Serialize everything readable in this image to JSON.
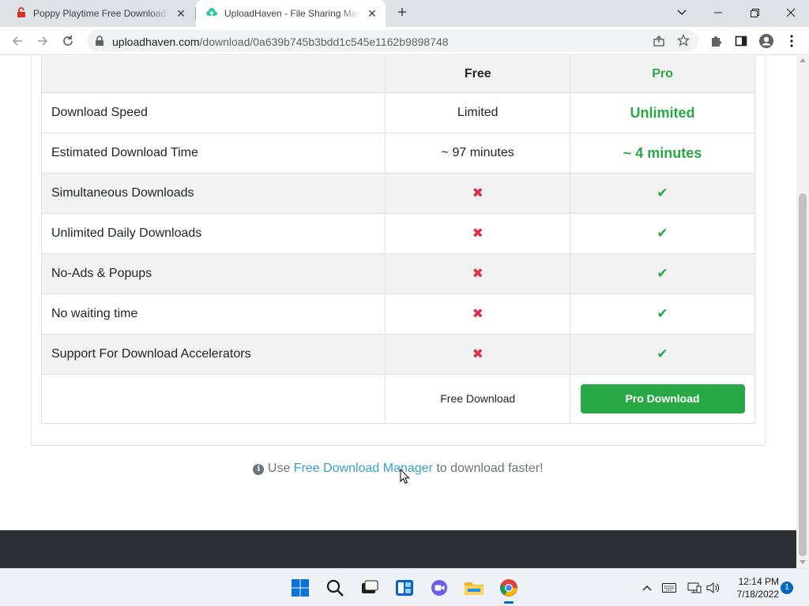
{
  "browser": {
    "tabs": [
      {
        "title": "Poppy Playtime Free Download (",
        "favicon": "lock-red-icon",
        "active": false
      },
      {
        "title": "UploadHaven - File Sharing Made",
        "favicon": "uploadhaven-cloud-icon",
        "active": true
      }
    ],
    "url_host": "uploadhaven.com",
    "url_path": "/download/0a639b745b3bdd1c545e1162b9898748"
  },
  "compare_table": {
    "header": {
      "feature": "",
      "free": "Free",
      "pro": "Pro"
    },
    "rows": [
      {
        "feature": "Download Speed",
        "free": "Limited",
        "pro": "Unlimited"
      },
      {
        "feature": "Estimated Download Time",
        "free": "~ 97 minutes",
        "pro": "~ 4 minutes"
      },
      {
        "feature": "Simultaneous Downloads",
        "free": "✖",
        "pro": "✔"
      },
      {
        "feature": "Unlimited Daily Downloads",
        "free": "✖",
        "pro": "✔"
      },
      {
        "feature": "No-Ads & Popups",
        "free": "✖",
        "pro": "✔"
      },
      {
        "feature": "No waiting time",
        "free": "✖",
        "pro": "✔"
      },
      {
        "feature": "Support For Download Accelerators",
        "free": "✖",
        "pro": "✔"
      }
    ],
    "free_button": "Free Download",
    "pro_button": "Pro Download"
  },
  "tip": {
    "prefix": "Use",
    "link": "Free Download Manager",
    "suffix": "to download faster!"
  },
  "taskbar": {
    "time": "12:14 PM",
    "date": "7/18/2022",
    "notifications": "1"
  },
  "colors": {
    "pro_green": "#28a745",
    "cross_red": "#d9324a",
    "link_blue": "#3aa0d0",
    "footer_dark": "#2d3035"
  }
}
